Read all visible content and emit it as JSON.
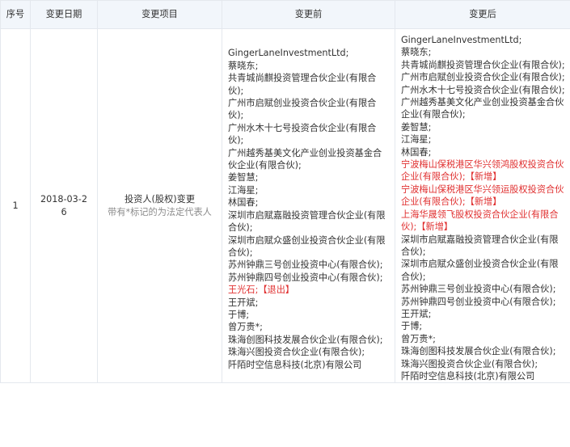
{
  "headers": [
    "序号",
    "变更日期",
    "变更项目",
    "变更前",
    "变更后"
  ],
  "row": {
    "index": "1",
    "date": "2018-03-26",
    "item": "投资人(股权)变更",
    "item_note": "带有*标记的为法定代表人",
    "before": [
      {
        "text": "GingerLaneInvestmentLtd;"
      },
      {
        "text": "蔡晓东;"
      },
      {
        "text": "共青城尚麒投资管理合伙企业(有限合伙);"
      },
      {
        "text": "广州市启赋创业投资合伙企业(有限合伙);"
      },
      {
        "text": "广州水木十七号投资合伙企业(有限合伙);"
      },
      {
        "text": "广州越秀基美文化产业创业投资基金合伙企业(有限合伙);"
      },
      {
        "text": "姜智慧;"
      },
      {
        "text": "江海星;"
      },
      {
        "text": "林国春;"
      },
      {
        "text": "深圳市启赋嘉融投资管理合伙企业(有限合伙);"
      },
      {
        "text": "深圳市启赋众盛创业投资合伙企业(有限合伙);"
      },
      {
        "text": "苏州钟鼎三号创业投资中心(有限合伙);"
      },
      {
        "text": "苏州钟鼎四号创业投资中心(有限合伙);"
      },
      {
        "text": "王光石;",
        "tag": "【退出】"
      },
      {
        "text": "王开斌;"
      },
      {
        "text": "于博;"
      },
      {
        "text": "曾万贵*;"
      },
      {
        "text": "珠海创图科技发展合伙企业(有限合伙);"
      },
      {
        "text": "珠海兴图投资合伙企业(有限合伙);"
      },
      {
        "text": "阡陌时空信息科技(北京)有限公司"
      }
    ],
    "after": [
      {
        "text": "GingerLaneInvestmentLtd;"
      },
      {
        "text": "蔡晓东;"
      },
      {
        "text": "共青城尚麒投资管理合伙企业(有限合伙);"
      },
      {
        "text": "广州市启赋创业投资合伙企业(有限合伙);"
      },
      {
        "text": "广州水木十七号投资合伙企业(有限合伙);"
      },
      {
        "text": "广州越秀基美文化产业创业投资基金合伙企业(有限合伙);"
      },
      {
        "text": "姜智慧;"
      },
      {
        "text": "江海星;"
      },
      {
        "text": "林国春;"
      },
      {
        "text": "宁波梅山保税港区华兴领鸿股权投资合伙企业(有限合伙);",
        "tag": "【新增】",
        "highlight": true
      },
      {
        "text": "宁波梅山保税港区华兴领运股权投资合伙企业(有限合伙);",
        "tag": "【新增】",
        "highlight": true
      },
      {
        "text": "上海华晟领飞股权投资合伙企业(有限合伙);",
        "tag": "【新增】",
        "highlight": true
      },
      {
        "text": "深圳市启赋嘉融投资管理合伙企业(有限合伙);"
      },
      {
        "text": "深圳市启赋众盛创业投资合伙企业(有限合伙);"
      },
      {
        "text": "苏州钟鼎三号创业投资中心(有限合伙);"
      },
      {
        "text": "苏州钟鼎四号创业投资中心(有限合伙);"
      },
      {
        "text": "王开斌;"
      },
      {
        "text": "于博;"
      },
      {
        "text": "曾万贵*;"
      },
      {
        "text": "珠海创图科技发展合伙企业(有限合伙);"
      },
      {
        "text": "珠海兴图投资合伙企业(有限合伙);"
      },
      {
        "text": "阡陌时空信息科技(北京)有限公司"
      }
    ]
  },
  "colors": {
    "header_bg": "#f2f6fb",
    "border": "#e4e8ee",
    "highlight": "#e03030",
    "hint": "#8c8c8c"
  }
}
